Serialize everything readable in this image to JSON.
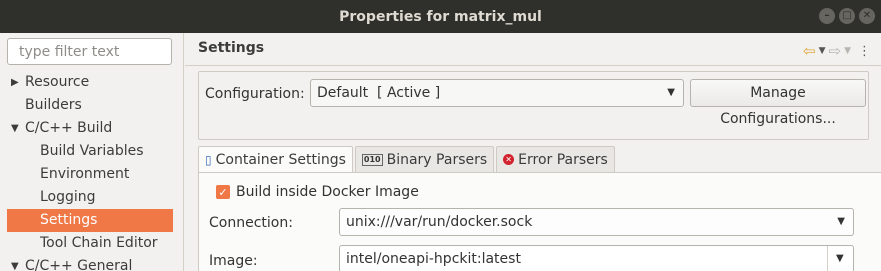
{
  "window": {
    "title": "Properties for matrix_mul",
    "buttons": [
      "–",
      "□",
      "✕"
    ]
  },
  "sidebar": {
    "filter_placeholder": "type filter text",
    "items": [
      {
        "label": "Resource",
        "arrow": "▶"
      },
      {
        "label": "Builders",
        "arrow": ""
      },
      {
        "label": "C/C++ Build",
        "arrow": "▼"
      },
      {
        "label": "Build Variables",
        "arrow": ""
      },
      {
        "label": "Environment",
        "arrow": ""
      },
      {
        "label": "Logging",
        "arrow": ""
      },
      {
        "label": "Settings",
        "arrow": "",
        "selected": true
      },
      {
        "label": "Tool Chain Editor",
        "arrow": ""
      },
      {
        "label": "C/C++ General",
        "arrow": "▼"
      }
    ]
  },
  "page": {
    "heading": "Settings",
    "nav": {
      "back_icon": "arrow-left-icon",
      "forward_icon": "arrow-right-icon",
      "menu_icon": "view-menu-icon"
    }
  },
  "configuration": {
    "label": "Configuration:",
    "value": "Default  [ Active ]",
    "manage_button": "Manage Configurations..."
  },
  "tabs": [
    {
      "label": "Container Settings",
      "icon": "container-icon",
      "active": true
    },
    {
      "label": "Binary Parsers",
      "icon": "binary-icon",
      "active": false
    },
    {
      "label": "Error Parsers",
      "icon": "error-icon",
      "active": false
    }
  ],
  "container_settings": {
    "build_in_docker_label": "Build inside Docker Image",
    "build_in_docker_checked": true,
    "connection_label": "Connection:",
    "connection_value": "unix:///var/run/docker.sock",
    "image_label": "Image:",
    "image_value": "intel/oneapi-hpckit:latest"
  },
  "colors": {
    "accent": "#f07746",
    "titlebar": "#2f2f2b"
  }
}
